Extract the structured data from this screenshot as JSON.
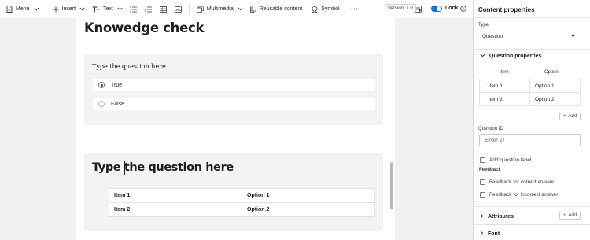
{
  "toolbar": {
    "menu_label": "Menu",
    "insert_label": "Insert",
    "text_label": "Text",
    "multimedia_label": "Multimedia",
    "reusable_label": "Reusable content",
    "symbol_label": "Symbol",
    "version_label": "Version: 1.0",
    "lock_label": "Lock",
    "lock_enabled": true
  },
  "editor": {
    "heading": "Knowedge check",
    "question1": {
      "prompt": "Type the question here",
      "options": [
        {
          "label": "True",
          "selected": true
        },
        {
          "label": "False",
          "selected": false
        }
      ]
    },
    "question2": {
      "title": "Type the question here",
      "rows": [
        {
          "item": "Item 1",
          "option": "Option 1"
        },
        {
          "item": "Item 2",
          "option": "Option 2"
        }
      ]
    }
  },
  "panel": {
    "title": "Content properties",
    "type_label": "Type",
    "type_value": "Question",
    "question_properties": {
      "title": "Question properties",
      "col_item": "Item",
      "col_option": "Option",
      "rows": [
        {
          "item": "Item 1",
          "option": "Option 1"
        },
        {
          "item": "Item 2",
          "option": "Option 2"
        }
      ],
      "add_label": "Add"
    },
    "question_id_label": "Question ID",
    "question_id_placeholder": "Enter ID",
    "add_question_label": "Add question label",
    "feedback_label": "Feedback",
    "feedback_correct": "Feedback for correct answer",
    "feedback_incorrect": "Feedback for incorrect answer",
    "attributes_label": "Attributes",
    "attributes_add_label": "Add",
    "font_label": "Font"
  },
  "colors": {
    "accent": "#1473e6",
    "canvas": "#f1f1f1",
    "card": "#f3f3f3"
  }
}
